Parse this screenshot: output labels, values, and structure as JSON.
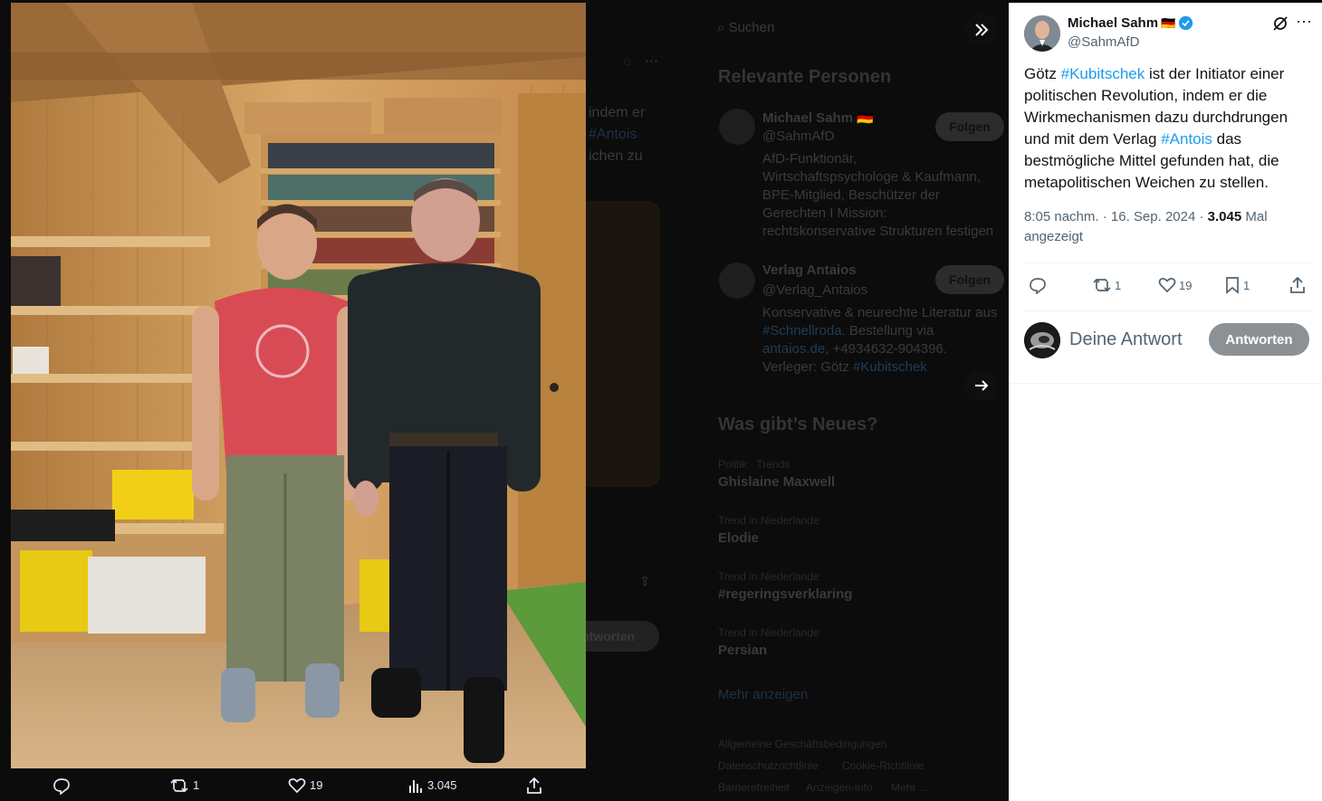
{
  "post": {
    "author_name": "Michael Sahm",
    "author_handle": "@SahmAfD",
    "flag": "🇩🇪",
    "text_parts": [
      "Götz ",
      "#Kubitschek",
      " ist der Initiator einer politischen Revolution, indem er die Wirkmechanismen dazu durchdrungen und mit dem Verlag ",
      "#Antois",
      " das bestmögliche Mittel gefunden hat, die metapolitischen Weichen zu stellen."
    ],
    "time": "8:05 nachm.",
    "date": "16. Sep. 2024",
    "views": "3.045",
    "views_label": "Mal angezeigt",
    "reply_count": "",
    "retweet_count": "1",
    "like_count": "19",
    "bookmark_count": "1"
  },
  "reply": {
    "placeholder": "Deine Antwort",
    "button_label": "Antworten"
  },
  "photo_bar": {
    "retweets": "1",
    "likes": "19",
    "views": "3.045"
  },
  "background": {
    "search_placeholder": "Suchen",
    "relevant_heading": "Relevante Personen",
    "people": [
      {
        "name": "Michael Sahm 🇩🇪",
        "handle": "@SahmAfD",
        "follow": "Folgen",
        "bio": [
          "AfD-Funktionär,",
          "Wirtschaftspsychologe & Kaufmann,",
          "BPE-Mitglied, Beschützer der",
          "Gerechten I Mission:",
          "rechtskonservative Strukturen festigen"
        ]
      },
      {
        "name": "Verlag Antaios",
        "handle": "@Verlag_Antaios",
        "follow": "Folgen",
        "bio_1": "Konservative & neurechte Literatur aus",
        "bio_tag": "#Schnellroda",
        "bio_2": ". Bestellung via",
        "bio_link": "antaios.de",
        "bio_3": ", +4934632-904396.",
        "bio_4": "Verleger: Götz ",
        "bio_tag2": "#Kubitschek"
      }
    ],
    "news_heading": "Was gibt’s Neues?",
    "trends": [
      {
        "context": "Politik · Trends",
        "title": "Ghislaine Maxwell"
      },
      {
        "context": "Trend in Niederlande",
        "title": "Elodie"
      },
      {
        "context": "Trend in Niederlande",
        "title": "#regeringsverklaring"
      },
      {
        "context": "Trend in Niederlande",
        "title": "Persian"
      }
    ],
    "show_more": "Mehr anzeigen",
    "footer": [
      "Allgemeine Geschäftsbedingungen",
      "Datenschutzrichtlinie",
      "Cookie-Richtlinie",
      "Barrierefreiheit",
      "Anzeigen-info",
      "Mehr ..."
    ],
    "tweet_fragments": [
      "indem er",
      "#Antois",
      "ichen zu"
    ],
    "antworten": "Antworten"
  },
  "colors": {
    "accent": "#1d9bf0",
    "verified": "#1d9bf0"
  }
}
